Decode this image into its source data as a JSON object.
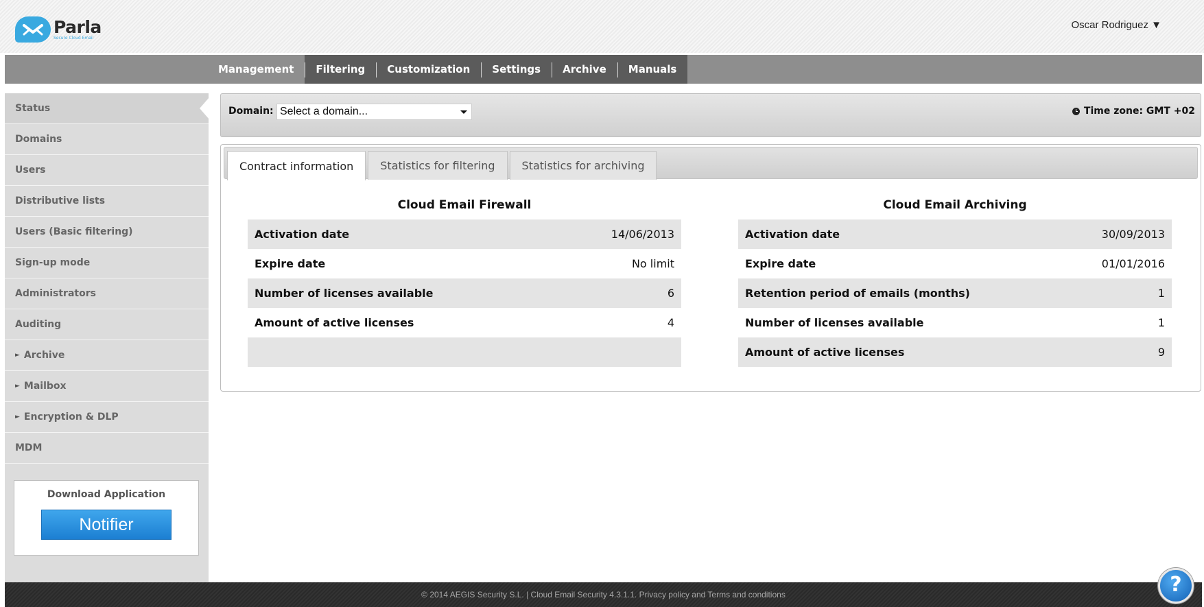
{
  "brand": {
    "name": "Parla",
    "tagline": "Secure Cloud Email",
    "logo_color": "#39a9e0"
  },
  "user": {
    "name": "Oscar Rodriguez ▼"
  },
  "main_nav": {
    "tabs": [
      {
        "label": "Management",
        "active": true
      },
      {
        "label": "Filtering"
      },
      {
        "label": "Customization"
      },
      {
        "label": "Settings"
      },
      {
        "label": "Archive"
      },
      {
        "label": "Manuals"
      }
    ]
  },
  "sidebar": {
    "items": [
      {
        "label": "Status",
        "active": true
      },
      {
        "label": "Domains"
      },
      {
        "label": "Users"
      },
      {
        "label": "Distributive lists"
      },
      {
        "label": "Users (Basic filtering)"
      },
      {
        "label": "Sign-up mode"
      },
      {
        "label": "Administrators"
      },
      {
        "label": "Auditing"
      },
      {
        "label": "Archive",
        "expandable": true
      },
      {
        "label": "Mailbox",
        "expandable": true
      },
      {
        "label": "Encryption & DLP",
        "expandable": true
      },
      {
        "label": "MDM"
      }
    ],
    "arrow_glyph": "►",
    "download": {
      "title": "Download Application",
      "button_label": "Notifier"
    }
  },
  "domain_bar": {
    "label": "Domain:",
    "select_value": "Select a domain...",
    "timezone": "Time zone: GMT +02"
  },
  "content_tabs": [
    {
      "label": "Contract information",
      "active": true
    },
    {
      "label": "Statistics for filtering"
    },
    {
      "label": "Statistics for archiving"
    }
  ],
  "firewall": {
    "title": "Cloud Email Firewall",
    "rows": [
      {
        "label": "Activation date",
        "value": "14/06/2013"
      },
      {
        "label": "Expire date",
        "value": "No limit"
      },
      {
        "label": "Number of licenses available",
        "value": "6"
      },
      {
        "label": "Amount of active licenses",
        "value": "4"
      },
      {
        "label": "",
        "value": ""
      }
    ]
  },
  "archiving": {
    "title": "Cloud Email Archiving",
    "rows": [
      {
        "label": "Activation date",
        "value": "30/09/2013"
      },
      {
        "label": "Expire date",
        "value": "01/01/2016"
      },
      {
        "label": "Retention period of emails (months)",
        "value": "1"
      },
      {
        "label": "Number of licenses available",
        "value": "1"
      },
      {
        "label": "Amount of active licenses",
        "value": "9"
      }
    ]
  },
  "footer": {
    "text": "© 2014 AEGIS Security S.L. | Cloud Email Security 4.3.1.1. Privacy policy and Terms and conditions"
  },
  "help": {
    "glyph": "?"
  }
}
